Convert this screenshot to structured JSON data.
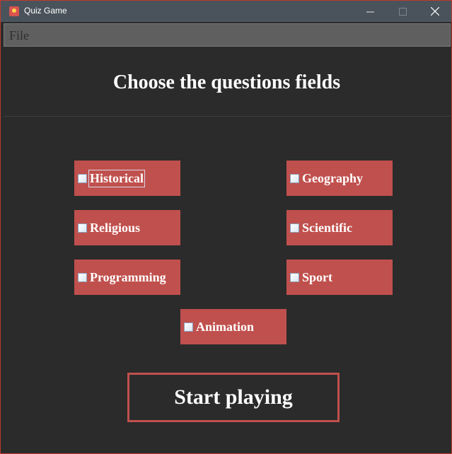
{
  "window": {
    "title": "Quiz Game",
    "controls": {
      "minimize": "—",
      "maximize": "☐",
      "close": "✕"
    }
  },
  "menubar": {
    "file_label": "File"
  },
  "main": {
    "heading": "Choose the questions fields",
    "fields": [
      {
        "label": "Historical",
        "checked": false
      },
      {
        "label": "Geography",
        "checked": false
      },
      {
        "label": "Religious",
        "checked": false
      },
      {
        "label": "Scientific",
        "checked": false
      },
      {
        "label": "Programming",
        "checked": false
      },
      {
        "label": "Sport",
        "checked": false
      },
      {
        "label": "Animation",
        "checked": false
      }
    ],
    "start_button": "Start playing"
  },
  "colors": {
    "accent": "#c0504d",
    "background": "#2b2b2b",
    "titlebar": "#4a535c",
    "menubar": "#5f5f5f",
    "text": "#ffffff"
  }
}
